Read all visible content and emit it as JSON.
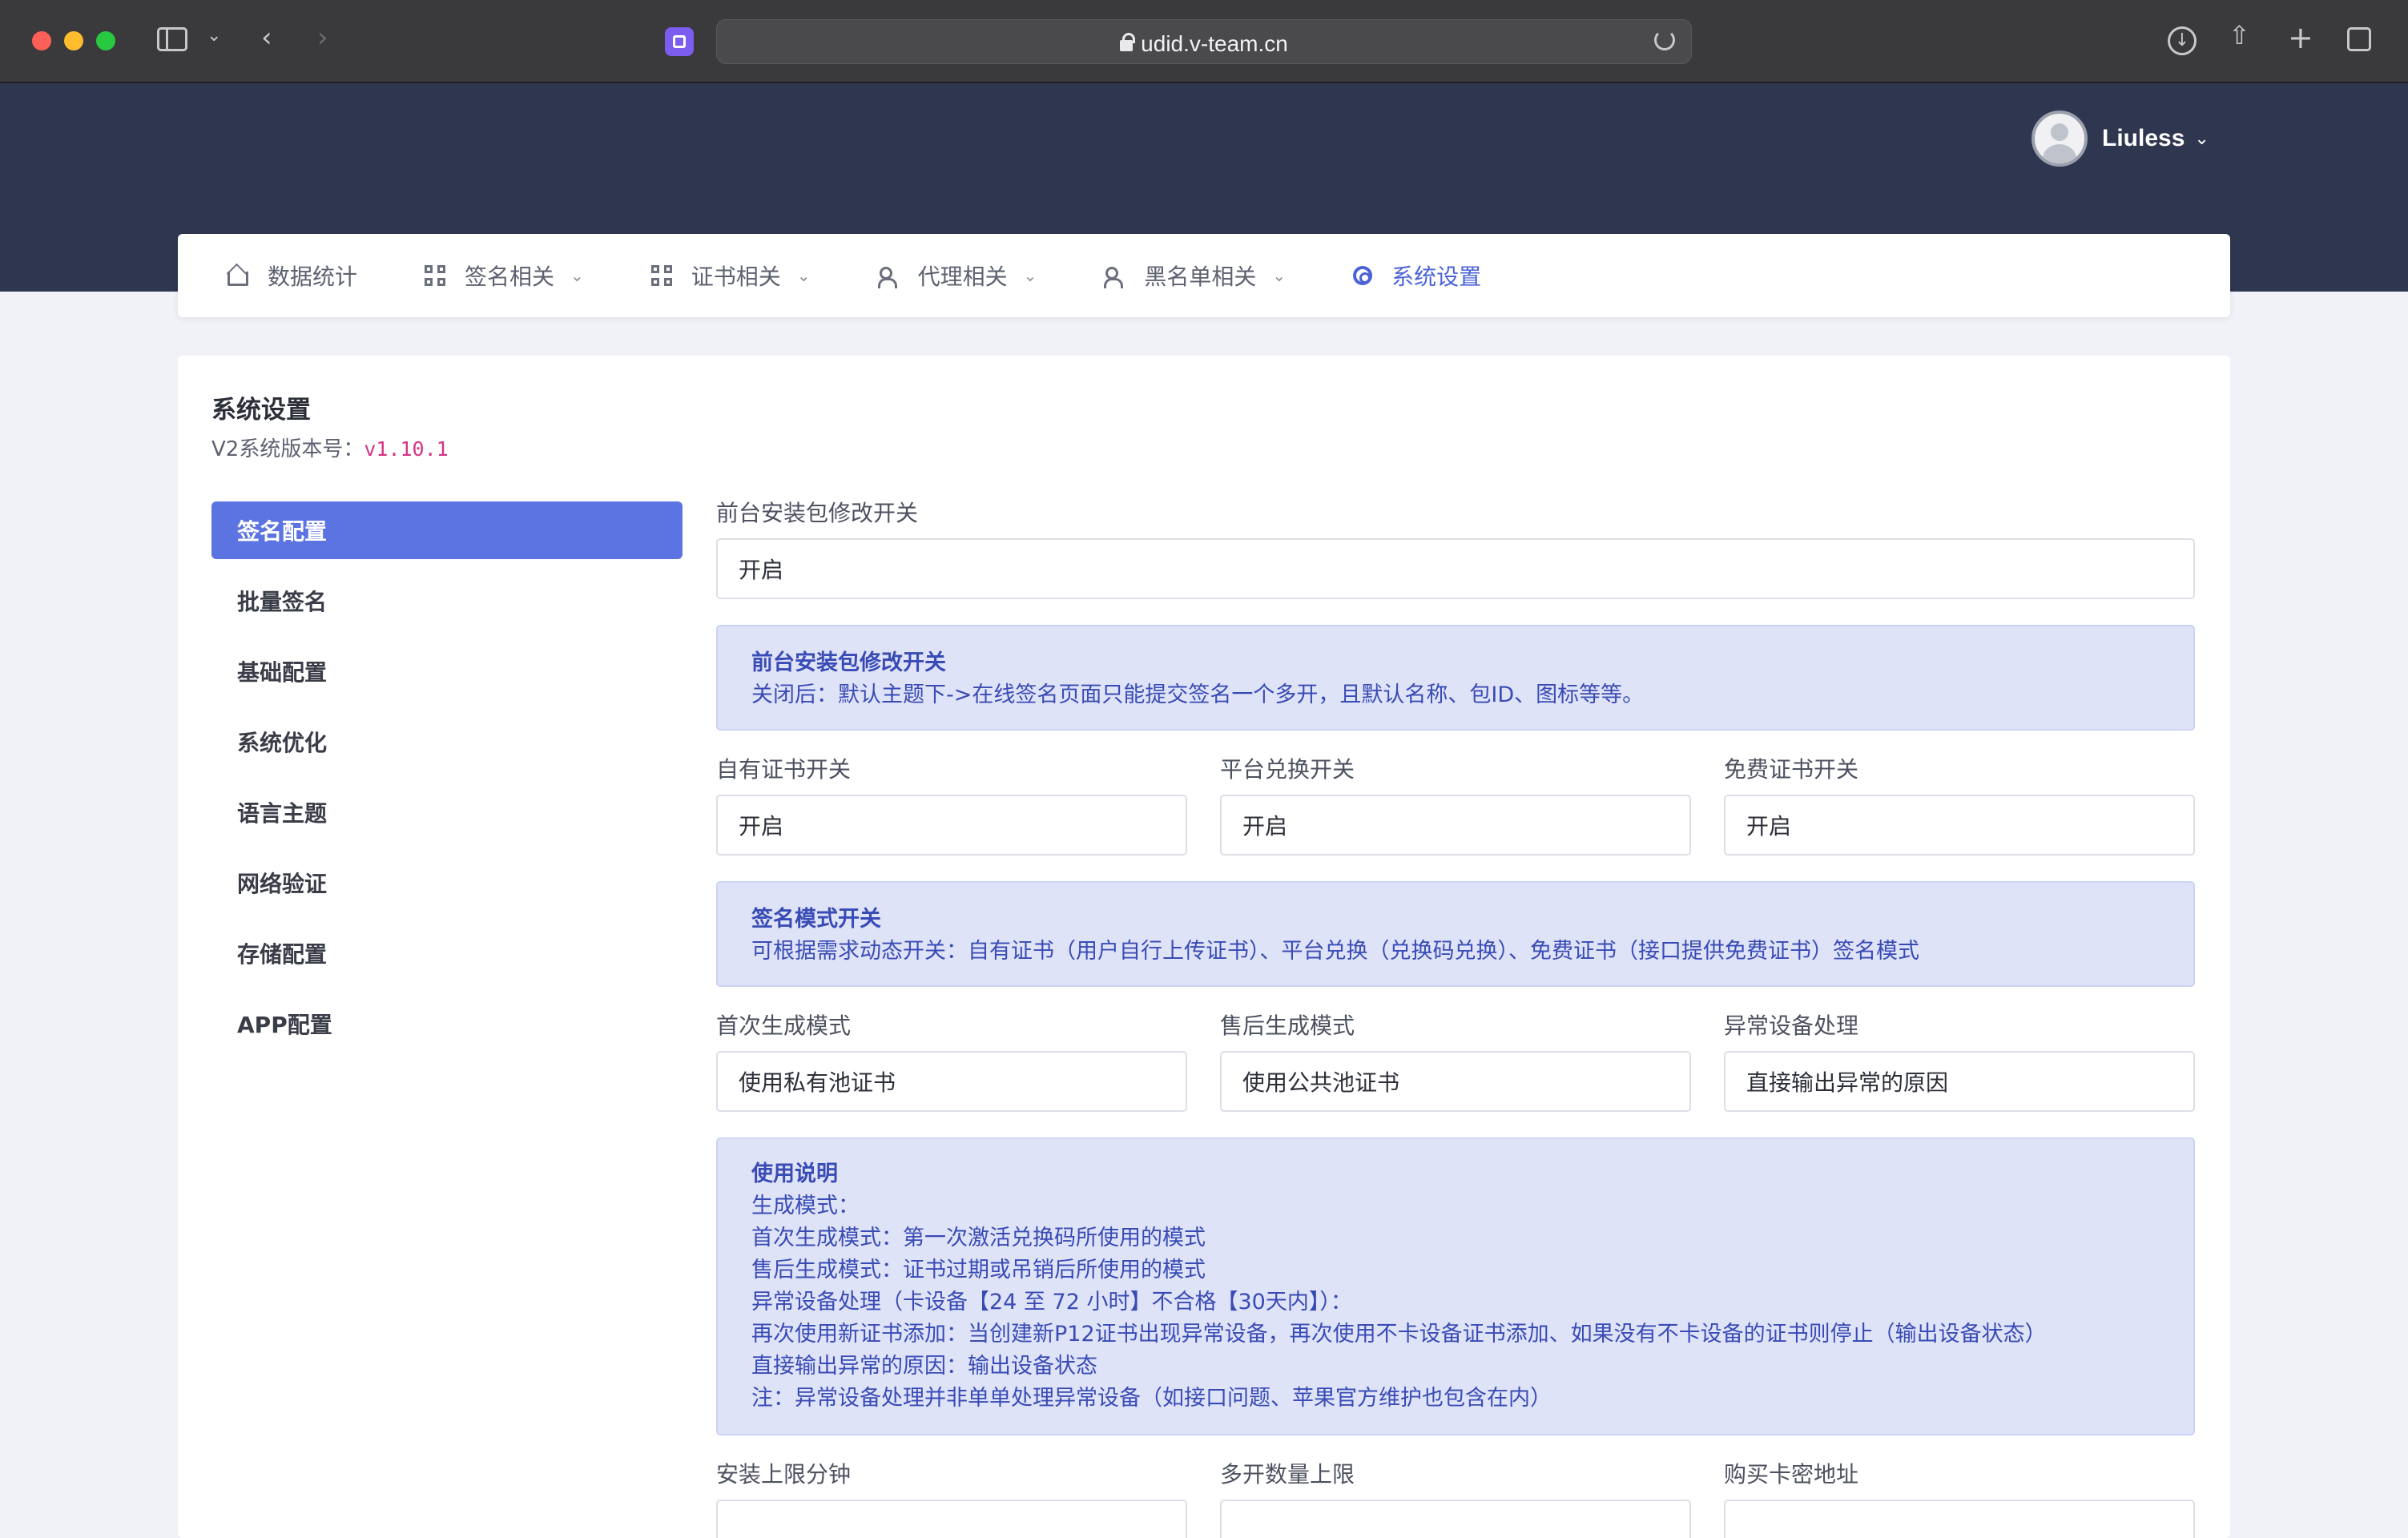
{
  "browser": {
    "url": "udid.v-team.cn"
  },
  "header": {
    "username": "Liuless"
  },
  "nav": {
    "items": [
      {
        "label": "数据统计",
        "icon": "home-icon"
      },
      {
        "label": "签名相关",
        "icon": "grid-icon"
      },
      {
        "label": "证书相关",
        "icon": "grid-icon"
      },
      {
        "label": "代理相关",
        "icon": "users-icon"
      },
      {
        "label": "黑名单相关",
        "icon": "users-icon"
      },
      {
        "label": "系统设置",
        "icon": "gear-icon"
      }
    ],
    "active_color": "#4a63d6"
  },
  "page": {
    "title": "系统设置",
    "version_label": "V2系统版本号：",
    "version_value": "v1.10.1"
  },
  "sidebar": {
    "items": [
      {
        "label": "签名配置"
      },
      {
        "label": "批量签名"
      },
      {
        "label": "基础配置"
      },
      {
        "label": "系统优化"
      },
      {
        "label": "语言主题"
      },
      {
        "label": "网络验证"
      },
      {
        "label": "存储配置"
      },
      {
        "label": "APP配置"
      }
    ],
    "active_color": "#5c74e2"
  },
  "form": {
    "install_switch": {
      "label": "前台安装包修改开关",
      "value": "开启"
    },
    "alert1": {
      "title": "前台安装包修改开关",
      "text": "关闭后：默认主题下->在线签名页面只能提交签名一个多开，且默认名称、包ID、图标等等。"
    },
    "own_cert": {
      "label": "自有证书开关",
      "value": "开启"
    },
    "platform_exchange": {
      "label": "平台兑换开关",
      "value": "开启"
    },
    "free_cert": {
      "label": "免费证书开关",
      "value": "开启"
    },
    "alert2": {
      "title": "签名模式开关",
      "text": "可根据需求动态开关：自有证书（用户自行上传证书）、平台兑换（兑换码兑换）、免费证书（接口提供免费证书）签名模式"
    },
    "first_mode": {
      "label": "首次生成模式",
      "value": "使用私有池证书"
    },
    "after_mode": {
      "label": "售后生成模式",
      "value": "使用公共池证书"
    },
    "abnormal": {
      "label": "异常设备处理",
      "value": "直接输出异常的原因"
    },
    "alert3": {
      "title": "使用说明",
      "lines": [
        "生成模式：",
        "首次生成模式：第一次激活兑换码所使用的模式",
        "售后生成模式：证书过期或吊销后所使用的模式",
        "异常设备处理（卡设备【24 至 72 小时】不合格【30天内】）：",
        "再次使用新证书添加：当创建新P12证书出现异常设备，再次使用不卡设备证书添加、如果没有不卡设备的证书则停止（输出设备状态）",
        "直接输出异常的原因：输出设备状态",
        "注：异常设备处理并非单单处理异常设备（如接口问题、苹果官方维护也包含在内）"
      ]
    },
    "install_limit": {
      "label": "安装上限分钟"
    },
    "multi_limit": {
      "label": "多开数量上限"
    },
    "buy_card": {
      "label": "购买卡密地址"
    }
  }
}
